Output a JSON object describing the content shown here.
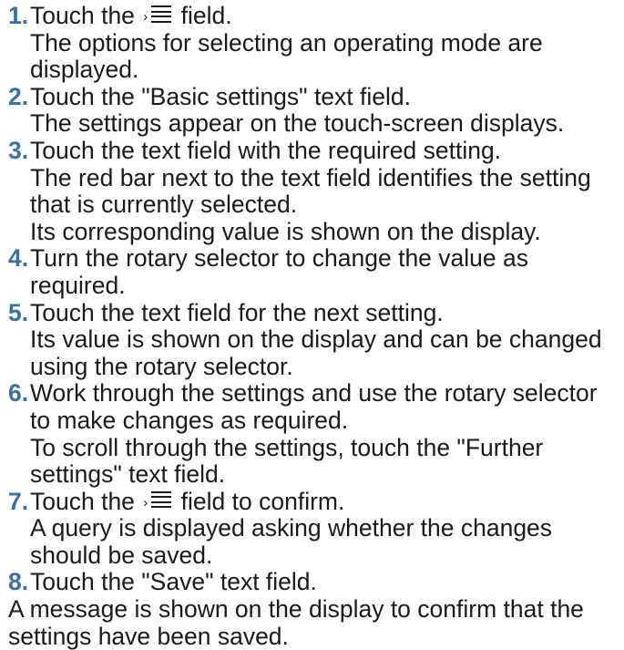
{
  "steps": [
    {
      "number": "1.",
      "before_icon": "Touch the",
      "icon": "menu-list-icon",
      "after_icon": "field.",
      "result": "The options for selecting an operating mode are displayed."
    },
    {
      "number": "2.",
      "instruction": "Touch the \"Basic settings\" text field.",
      "result": "The settings appear on the touch-screen displays."
    },
    {
      "number": "3.",
      "instruction": "Touch the text field with the required setting.",
      "result": "The red bar next to the text field identifies the setting that is currently selected.",
      "result2": "Its corresponding value is shown on the display."
    },
    {
      "number": "4.",
      "instruction": "Turn the rotary selector to change the value as required."
    },
    {
      "number": "5.",
      "instruction": "Touch the text field for the next setting.",
      "result": "Its value is shown on the display and can be changed using the rotary selector."
    },
    {
      "number": "6.",
      "instruction": "Work through the settings and use the rotary selector to make changes as required.",
      "result": "To scroll through the settings, touch the \"Further settings\" text field."
    },
    {
      "number": "7.",
      "before_icon": "Touch the",
      "icon": "menu-list-icon",
      "after_icon": "field to confirm.",
      "result": "A query is displayed asking whether the changes should be saved."
    },
    {
      "number": "8.",
      "instruction": "Touch the \"Save\" text field."
    }
  ],
  "final_note": "A message is shown on the display to confirm that the settings have been saved.",
  "colors": {
    "step_number": "#3a6fa8",
    "text": "#1a1a1a"
  }
}
